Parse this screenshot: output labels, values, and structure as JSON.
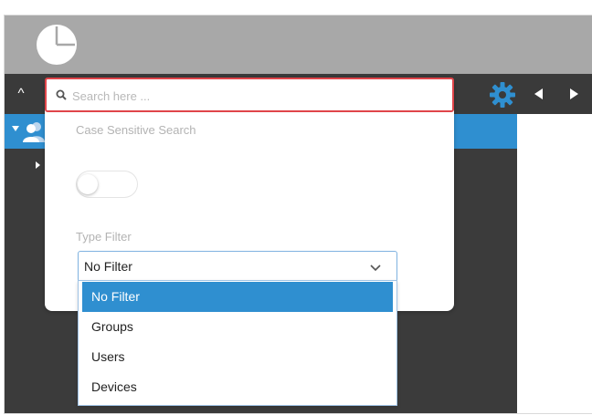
{
  "toolbar": {
    "collapse_symbol": "^",
    "gear_icon": "gear-icon",
    "nav_left_icon": "triangle-left-icon",
    "nav_right_icon": "triangle-right-icon"
  },
  "search": {
    "placeholder": "Search here ...",
    "value": "",
    "case_sensitive_label": "Case Sensitive Search",
    "case_sensitive_on": false,
    "type_filter_label": "Type Filter",
    "type_filter_value": "No Filter",
    "type_filter_options": [
      "No Filter",
      "Groups",
      "Users",
      "Devices"
    ],
    "type_filter_selected_index": 0
  },
  "colors": {
    "accent": "#2f8fd0",
    "highlight_border": "#e0454a",
    "topbar": "#a8a8a8",
    "sidebar": "#3a3a3a"
  }
}
